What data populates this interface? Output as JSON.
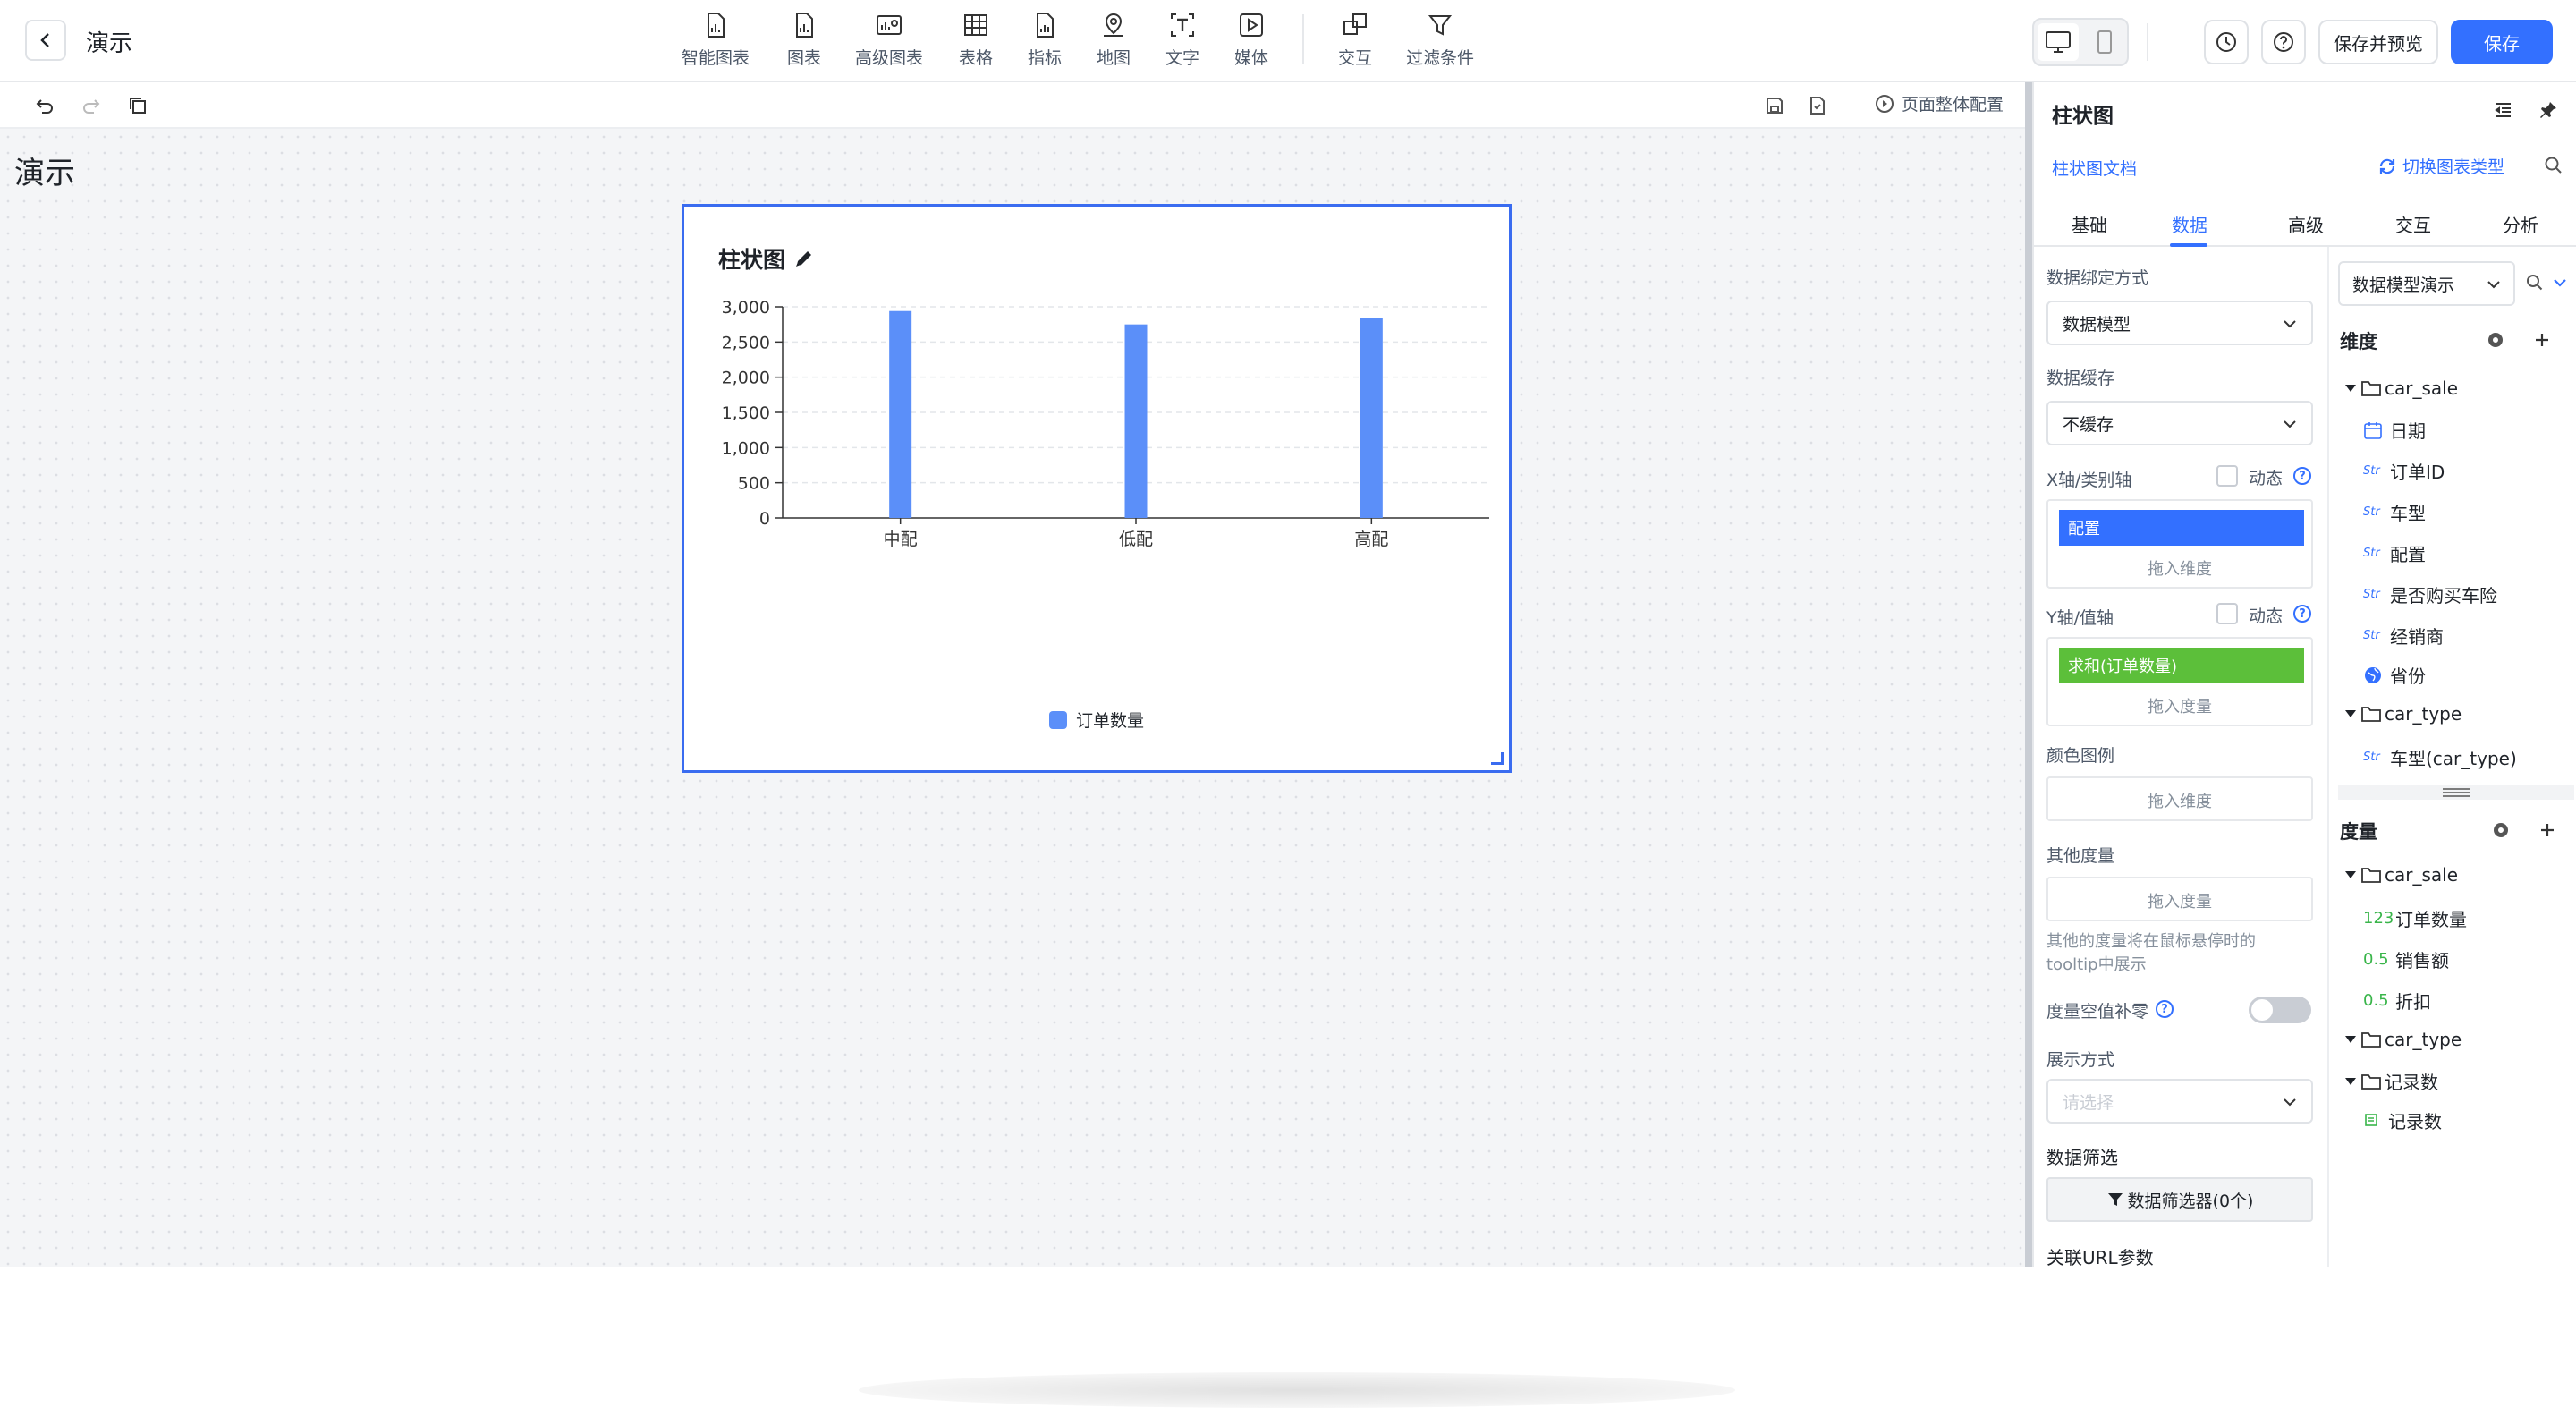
{
  "header": {
    "title": "演示",
    "tools": [
      {
        "label": "智能图表",
        "icon": "smart-chart-icon"
      },
      {
        "label": "图表",
        "icon": "chart-icon"
      },
      {
        "label": "高级图表",
        "icon": "advanced-chart-icon"
      },
      {
        "label": "表格",
        "icon": "table-icon"
      },
      {
        "label": "指标",
        "icon": "metric-icon"
      },
      {
        "label": "地图",
        "icon": "map-icon"
      },
      {
        "label": "文字",
        "icon": "text-icon"
      },
      {
        "label": "媒体",
        "icon": "media-icon"
      },
      {
        "label": "交互",
        "icon": "interaction-icon"
      },
      {
        "label": "过滤条件",
        "icon": "filter-icon"
      }
    ],
    "save_preview_label": "保存并预览",
    "save_label": "保存"
  },
  "subbar": {
    "page_config_label": "页面整体配置"
  },
  "canvas": {
    "page_heading": "演示",
    "chart_title": "柱状图"
  },
  "chart_data": {
    "type": "bar",
    "title": "柱状图",
    "categories": [
      "中配",
      "低配",
      "高配"
    ],
    "series": [
      {
        "name": "订单数量",
        "values": [
          2940,
          2750,
          2840
        ],
        "color": "#5b8ff9"
      }
    ],
    "yticks": [
      "0",
      "500",
      "1,000",
      "1,500",
      "2,000",
      "2,500",
      "3,000"
    ],
    "ylim": [
      0,
      3000
    ],
    "grid": true,
    "legend_position": "bottom"
  },
  "panel": {
    "title": "柱状图",
    "doc_link": "柱状图文档",
    "switch_type": "切换图表类型",
    "tabs": [
      "基础",
      "数据",
      "高级",
      "交互",
      "分析"
    ],
    "active_tab": "数据",
    "binding_label": "数据绑定方式",
    "binding_value": "数据模型",
    "cache_label": "数据缓存",
    "cache_value": "不缓存",
    "x_axis_label": "X轴/类别轴",
    "dynamic_label": "动态",
    "x_field": "配置",
    "drop_dimension": "拖入维度",
    "y_axis_label": "Y轴/值轴",
    "y_field": "求和(订单数量)",
    "drop_measure": "拖入度量",
    "color_legend_label": "颜色图例",
    "other_measure_label": "其他度量",
    "other_measure_note_1": "其他的度量将在鼠标悬停时的",
    "other_measure_note_2": "tooltip中展示",
    "null_fill_label": "度量空值补零",
    "display_label": "展示方式",
    "display_placeholder": "请选择",
    "filter_label": "数据筛选",
    "filter_button": "数据筛选器(0个)",
    "url_param_label": "关联URL参数",
    "model_select": "数据模型演示",
    "dimension_title": "维度",
    "measure_title": "度量",
    "dimensions": {
      "folder1": "car_sale",
      "items1": [
        {
          "type": "date",
          "label": "日期"
        },
        {
          "type": "Str",
          "label": "订单ID"
        },
        {
          "type": "Str",
          "label": "车型"
        },
        {
          "type": "Str",
          "label": "配置"
        },
        {
          "type": "Str",
          "label": "是否购买车险"
        },
        {
          "type": "Str",
          "label": "经销商"
        },
        {
          "type": "geo",
          "label": "省份"
        }
      ],
      "folder2": "car_type",
      "items2": [
        {
          "type": "Str",
          "label": "车型(car_type)"
        }
      ]
    },
    "measures": {
      "folder1": "car_sale",
      "items1": [
        {
          "type": "123",
          "label": "订单数量"
        },
        {
          "type": "0.5",
          "label": "销售额"
        },
        {
          "type": "0.5",
          "label": "折扣"
        }
      ],
      "folder2": "car_type",
      "folder3": "记录数",
      "items3": [
        {
          "type": "count",
          "label": "记录数"
        }
      ]
    }
  }
}
